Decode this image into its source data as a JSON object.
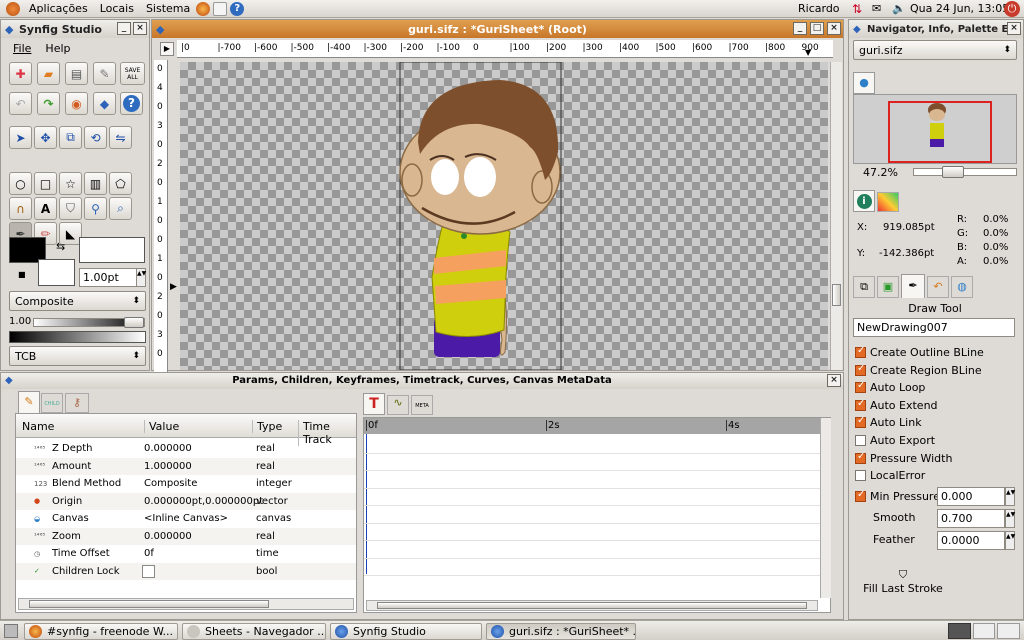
{
  "top_panel": {
    "menus": [
      "Aplicações",
      "Locais",
      "Sistema"
    ],
    "user": "Ricardo",
    "clock": "Qua 24 Jun, 13:05"
  },
  "toolbox": {
    "title": "Synfig Studio",
    "menus": [
      "File",
      "Help"
    ],
    "save_all_label": "SAVE ALL",
    "width_value": "1.00pt",
    "blend_method": "Composite",
    "opacity_value": "1.00",
    "interpolation": "TCB"
  },
  "canvas_window": {
    "title": "guri.sifz : *GuriSheet* (Root)",
    "ruler_h": [
      "|0",
      "|-700",
      "|-600",
      "|-500",
      "|-400",
      "|-300",
      "|-200",
      "|-100",
      "0",
      "|100",
      "|200",
      "|300",
      "|400",
      "|500",
      "|600",
      "|700",
      "|800",
      "900"
    ],
    "ruler_v": [
      "0",
      "4",
      "0",
      "3",
      "0",
      "2",
      "0",
      "1",
      "0",
      "0",
      "1",
      "0",
      "2",
      "0",
      "3",
      "0"
    ]
  },
  "params_panel": {
    "title": "Params, Children, Keyframes, Timetrack, Curves, Canvas MetaData",
    "columns": [
      "Name",
      "Value",
      "Type",
      "Time Track"
    ],
    "tab_child": "CHILD",
    "tab_meta": "META",
    "rows": [
      {
        "name": "Z Depth",
        "value": "0.000000",
        "type": "real",
        "icon": "real-icon"
      },
      {
        "name": "Amount",
        "value": "1.000000",
        "type": "real",
        "icon": "real-icon"
      },
      {
        "name": "Blend Method",
        "value": "Composite",
        "type": "integer",
        "icon": "integer-icon"
      },
      {
        "name": "Origin",
        "value": "0.000000pt,0.000000pt",
        "type": "vector",
        "icon": "vector-icon"
      },
      {
        "name": "Canvas",
        "value": "<Inline Canvas>",
        "type": "canvas",
        "icon": "canvas-icon"
      },
      {
        "name": "Zoom",
        "value": "0.000000",
        "type": "real",
        "icon": "real-icon"
      },
      {
        "name": "Time Offset",
        "value": "0f",
        "type": "time",
        "icon": "time-icon"
      },
      {
        "name": "Children Lock",
        "value": "",
        "type": "bool",
        "icon": "bool-icon"
      }
    ],
    "timeline_marks": [
      "0f",
      "2s",
      "4s"
    ]
  },
  "navigator": {
    "title": "Navigator, Info, Palette E",
    "file": "guri.sifz",
    "zoom": "47.2%"
  },
  "info": {
    "x_label": "X:",
    "x_value": "919.085pt",
    "y_label": "Y:",
    "y_value": "-142.386pt",
    "r_label": "R:",
    "r": "0.0%",
    "g_label": "G:",
    "g": "0.0%",
    "b_label": "B:",
    "b": "0.0%",
    "a_label": "A:",
    "a": "0.0%"
  },
  "draw_tool": {
    "title": "Draw Tool",
    "name": "NewDrawing007",
    "options": [
      {
        "label": "Create Outline BLine",
        "checked": true
      },
      {
        "label": "Create Region BLine",
        "checked": true
      },
      {
        "label": "Auto Loop",
        "checked": true
      },
      {
        "label": "Auto Extend",
        "checked": true
      },
      {
        "label": "Auto Link",
        "checked": true
      },
      {
        "label": "Auto Export",
        "checked": false
      },
      {
        "label": "Pressure Width",
        "checked": true
      },
      {
        "label": "LocalError",
        "checked": false
      }
    ],
    "min_pressure_label": "Min Pressure",
    "min_pressure": "0.000",
    "smooth_label": "Smooth",
    "smooth": "0.700",
    "feather_label": "Feather",
    "feather": "0.0000",
    "fill_last_stroke": "Fill Last Stroke"
  },
  "taskbar": [
    {
      "label": "#synfig - freenode W...",
      "icon": "firefox-icon"
    },
    {
      "label": "Sheets - Navegador ...",
      "icon": "browser-icon"
    },
    {
      "label": "Synfig Studio",
      "icon": "synfig-icon"
    },
    {
      "label": "guri.sifz : *GuriSheet* ...",
      "icon": "synfig-icon",
      "active": true
    }
  ]
}
